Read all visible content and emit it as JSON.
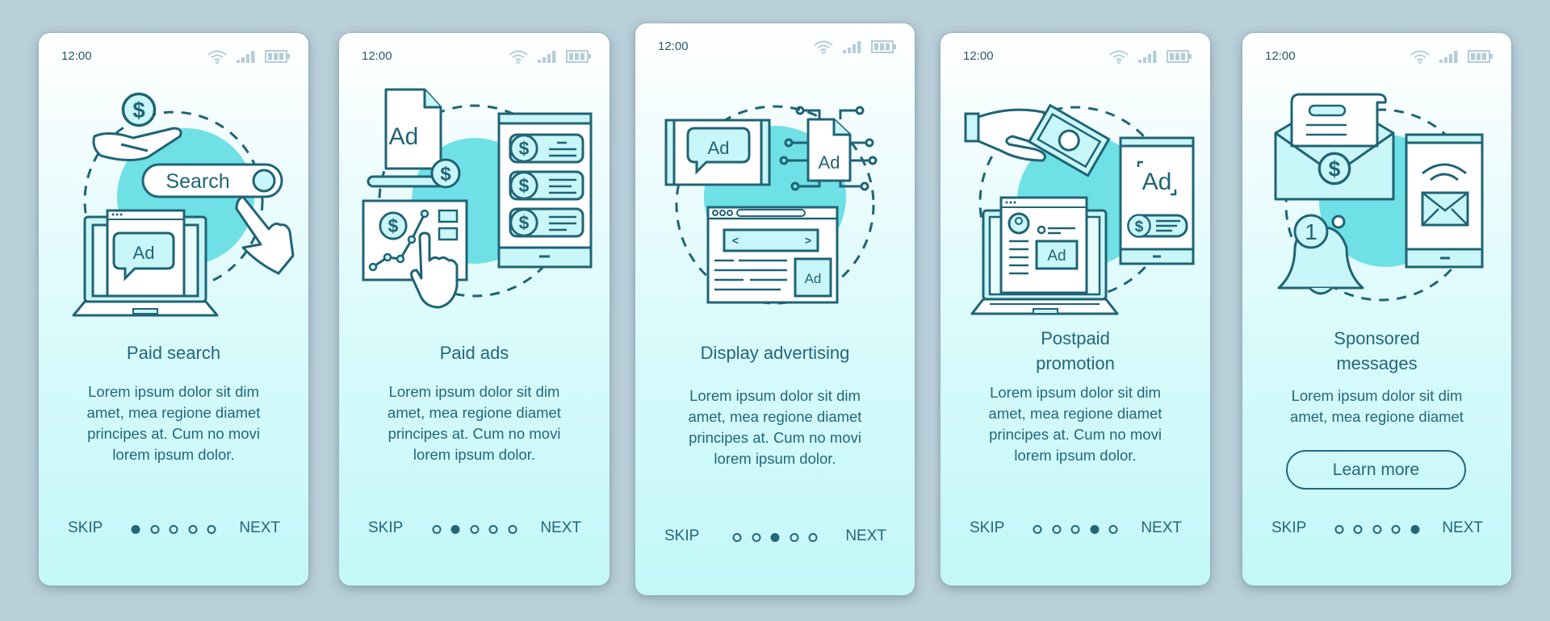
{
  "colors": {
    "background": "#b9cfd9",
    "accent_stroke": "#1f6475",
    "blob": "#6ee0e6",
    "status_icons": "#b5cdd6",
    "text": "#22677a"
  },
  "status_bar": {
    "time": "12:00",
    "icons": [
      "wifi-icon",
      "signal-icon",
      "battery-icon"
    ]
  },
  "nav": {
    "skip": "SKIP",
    "next": "NEXT",
    "total_pages": 5
  },
  "screens": [
    {
      "title_lines": [
        "Paid search"
      ],
      "body_lines": [
        "Lorem ipsum dolor sit dim",
        "amet, mea regione diamet",
        "principes at. Cum no movi",
        "lorem ipsum dolor."
      ],
      "active_page": 1,
      "illustration": "paid-search-illustration",
      "illustration_text": {
        "search": "Search",
        "ad": "Ad",
        "currency": "$"
      }
    },
    {
      "title_lines": [
        "Paid ads"
      ],
      "body_lines": [
        "Lorem ipsum dolor sit dim",
        "amet, mea regione diamet",
        "principes at. Cum no movi",
        "lorem ipsum dolor."
      ],
      "active_page": 2,
      "illustration": "paid-ads-illustration",
      "illustration_text": {
        "ad": "Ad",
        "currency": "$"
      }
    },
    {
      "title_lines": [
        "Display advertising"
      ],
      "body_lines": [
        "Lorem ipsum dolor sit dim",
        "amet, mea regione diamet",
        "principes at. Cum no movi",
        "lorem ipsum dolor."
      ],
      "active_page": 3,
      "illustration": "display-advertising-illustration",
      "illustration_text": {
        "ad": "Ad",
        "prev": "<",
        "next": ">"
      }
    },
    {
      "title_lines": [
        "Postpaid",
        "promotion"
      ],
      "body_lines": [
        "Lorem ipsum dolor sit dim",
        "amet, mea regione diamet",
        "principes at. Cum no movi",
        "lorem ipsum dolor."
      ],
      "active_page": 4,
      "illustration": "postpaid-promotion-illustration",
      "illustration_text": {
        "ad": "Ad",
        "currency": "$"
      }
    },
    {
      "title_lines": [
        "Sponsored",
        "messages"
      ],
      "body_lines": [
        "Lorem ipsum dolor sit dim",
        "amet, mea regione diamet"
      ],
      "active_page": 5,
      "button_label": "Learn more",
      "illustration": "sponsored-messages-illustration",
      "illustration_text": {
        "badge": "1",
        "currency": "$"
      }
    }
  ]
}
